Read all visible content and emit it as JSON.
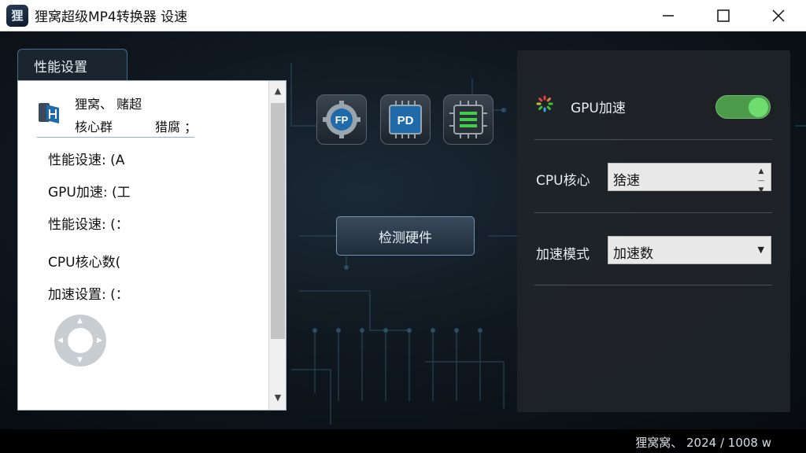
{
  "window": {
    "title": "狸窝超级MP4转换器 设速",
    "app_icon_glyph": "狸",
    "controls": {
      "minimize_icon": "minimize-icon",
      "maximize_icon": "maximize-icon",
      "close_icon": "close-icon"
    }
  },
  "left_panel": {
    "tab_label": "性能设置",
    "header_line1": "狸窝、 赌超",
    "header_line2a": "核心群",
    "header_line2b": "猎腐 ；",
    "items": [
      "性能设速: (A",
      "GPU加速: (工",
      "性能设速: (：",
      "CPU核心数(",
      "加速设置: (："
    ]
  },
  "center": {
    "icons": [
      "fp-gear-icon",
      "pd-chip-icon",
      "cpu-chip-icon"
    ],
    "fp_text": "FP",
    "pd_text": "PD",
    "detect_button": "检测硬件"
  },
  "right_panel": {
    "gpu_label": "GPU加速",
    "gpu_enabled": true,
    "cpu_label": "CPU核心",
    "cpu_value": "猞速",
    "mode_label": "加速模式",
    "mode_value": "加速数"
  },
  "status": {
    "text": "狸窝窝、 2024 / 1008 w"
  },
  "colors": {
    "toggle_on": "#4a9a4a",
    "accent": "#6f93b6"
  }
}
